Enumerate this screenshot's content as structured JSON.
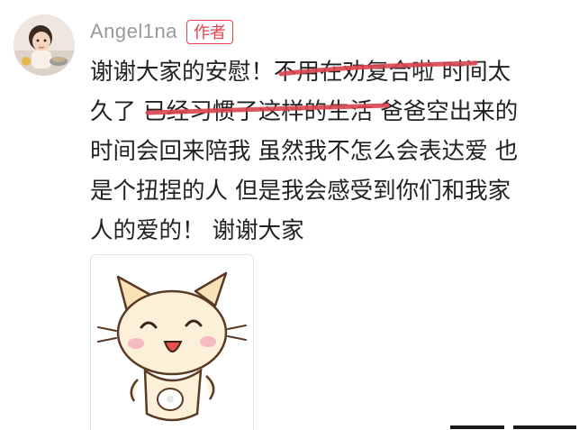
{
  "comment": {
    "author": "Angel1na",
    "author_badge": "作者",
    "lines": [
      "谢谢大家的安慰！不用在劝复合啦 时间太",
      "久了 已经习惯了这样的生活 爸爸空出来的",
      "时间会回来陪我 虽然我不怎么会表达爱 也",
      "是个扭捏的人 但是我会感受到你们和我家",
      "人的爱的！ 谢谢大家"
    ],
    "highlight_color": "#d9444e",
    "sticker_icon": "cute-cat-sticker"
  }
}
